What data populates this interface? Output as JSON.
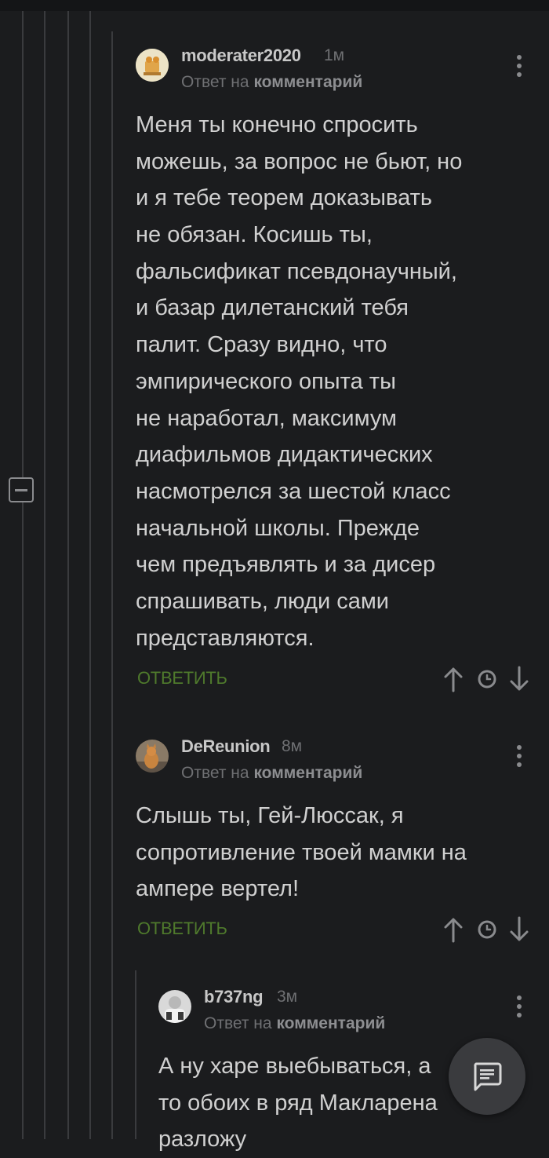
{
  "comments": [
    {
      "username": "moderater2020",
      "age": "1м",
      "reply_prefix": "Ответ на",
      "reply_target": "комментарий",
      "text_lines": [
        "Меня ты конечно спросить",
        "можешь, за вопрос не бьют, но",
        "и я тебе теорем доказывать",
        "не обязан. Косишь ты,",
        "фальсификат псевдонаучный,",
        "и базар дилетанский тебя",
        "палит. Сразу видно, что",
        "эмпирического опыта ты",
        "не наработал, максимум",
        "диафильмов дидактических",
        "насмотрелся за шестой класс",
        "начальной школы. Прежде",
        "чем предъявлять и за дисер",
        "спрашивать, люди сами",
        "представляются."
      ],
      "reply_button": "ОТВЕТИТЬ"
    },
    {
      "username": "DeReunion",
      "age": "8м",
      "reply_prefix": "Ответ на",
      "reply_target": "комментарий",
      "text_lines": [
        "Слышь ты, Гей-Люссак, я",
        "сопротивление твоей мамки на",
        "ампере вертел!"
      ],
      "reply_button": "ОТВЕТИТЬ"
    },
    {
      "username": "b737ng",
      "age": "3м",
      "reply_prefix": "Ответ на",
      "reply_target": "комментарий",
      "text_lines": [
        "А ну харе выебываться, а",
        "то обоих в ряд Макларена",
        "разложу"
      ]
    }
  ],
  "icons": {
    "collapse": "minus-square-icon",
    "more": "more-vertical-icon",
    "upvote": "arrow-up-icon",
    "history": "clock-icon",
    "downvote": "arrow-down-icon",
    "fab": "comment-icon"
  },
  "colors": {
    "background": "#1b1c1e",
    "reply_button": "#4f7a2c",
    "thread_line": "#3a3b3e"
  }
}
